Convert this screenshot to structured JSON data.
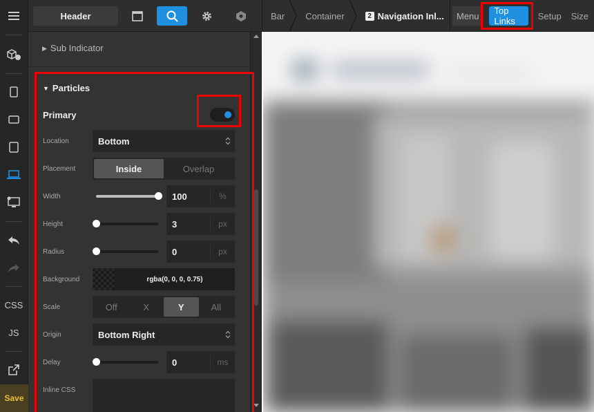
{
  "toolbar": {
    "header_label": "Header",
    "icons": [
      "window-icon",
      "search-icon",
      "gear-icon",
      "hexagon-icon"
    ]
  },
  "breadcrumbs": {
    "items": [
      "Bar",
      "Container"
    ],
    "current_badge": "2",
    "current": "Navigation Inl..."
  },
  "tabs": {
    "menu": "Menu",
    "top_links": "Top Links",
    "setup": "Setup",
    "size": "Size"
  },
  "rail": {
    "css": "CSS",
    "js": "JS",
    "save": "Save"
  },
  "panel": {
    "sub_indicator": "Sub Indicator",
    "particles_title": "Particles",
    "primary_label": "Primary",
    "primary_enabled": true,
    "location": {
      "label": "Location",
      "value": "Bottom"
    },
    "placement": {
      "label": "Placement",
      "options": [
        "Inside",
        "Overlap"
      ],
      "selected": "Inside"
    },
    "width": {
      "label": "Width",
      "value": "100",
      "unit": "%",
      "fraction": 1.0
    },
    "height": {
      "label": "Height",
      "value": "3",
      "unit": "px",
      "fraction": 0.0
    },
    "radius": {
      "label": "Radius",
      "value": "0",
      "unit": "px",
      "fraction": 0.0
    },
    "background": {
      "label": "Background",
      "value": "rgba(0, 0, 0, 0.75)"
    },
    "scale": {
      "label": "Scale",
      "options": [
        "Off",
        "X",
        "Y",
        "All"
      ],
      "selected": "Y"
    },
    "origin": {
      "label": "Origin",
      "value": "Bottom Right"
    },
    "delay": {
      "label": "Delay",
      "value": "0",
      "unit": "ms",
      "fraction": 0.0
    },
    "inline_css": {
      "label": "Inline CSS"
    }
  },
  "colors": {
    "accent": "#1f8fe0",
    "highlight": "#e00000",
    "save": "#e8c23a"
  }
}
